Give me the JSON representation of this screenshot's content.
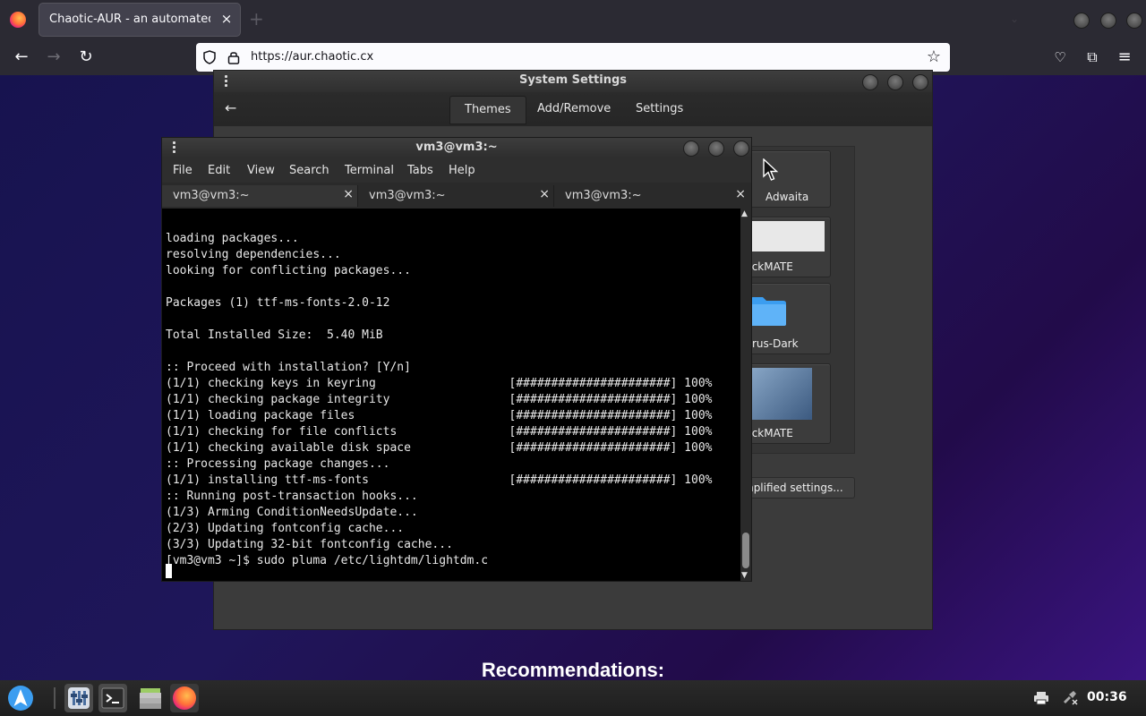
{
  "browser": {
    "tab_title": "Chaotic-AUR - an automated building repo for AUR packages",
    "tab_close": "×",
    "new_tab": "+",
    "url": "https://aur.chaotic.cx"
  },
  "page": {
    "heading": "Recommendations:"
  },
  "system_settings": {
    "title": "System Settings",
    "back": "←",
    "tabs": [
      "Themes",
      "Add/Remove",
      "Settings"
    ],
    "themes": [
      {
        "label": "Adwaita"
      },
      {
        "label": "lackMATE"
      },
      {
        "label": "pirus-Dark"
      },
      {
        "label": "lackMATE"
      }
    ],
    "simplified_button": "mplified settings..."
  },
  "terminal": {
    "title": "vm3@vm3:~",
    "menu": [
      "File",
      "Edit",
      "View",
      "Search",
      "Terminal",
      "Tabs",
      "Help"
    ],
    "tabs": [
      {
        "label": "vm3@vm3:~",
        "close": "×"
      },
      {
        "label": "vm3@vm3:~",
        "close": "×"
      },
      {
        "label": "vm3@vm3:~",
        "close": "×"
      }
    ],
    "lines": [
      "loading packages...",
      "resolving dependencies...",
      "looking for conflicting packages...",
      "",
      "Packages (1) ttf-ms-fonts-2.0-12",
      "",
      "Total Installed Size:  5.40 MiB",
      "",
      ":: Proceed with installation? [Y/n]",
      "(1/1) checking keys in keyring                   [######################] 100%",
      "(1/1) checking package integrity                 [######################] 100%",
      "(1/1) loading package files                      [######################] 100%",
      "(1/1) checking for file conflicts                [######################] 100%",
      "(1/1) checking available disk space              [######################] 100%",
      ":: Processing package changes...",
      "(1/1) installing ttf-ms-fonts                    [######################] 100%",
      ":: Running post-transaction hooks...",
      "(1/3) Arming ConditionNeedsUpdate...",
      "(2/3) Updating fontconfig cache...",
      "(3/3) Updating 32-bit fontconfig cache...",
      "[vm3@vm3 ~]$ sudo pluma /etc/lightdm/lightdm.c"
    ]
  },
  "taskbar": {
    "clock": "00:36"
  },
  "colors": {
    "page_bg": "#1f165a",
    "terminal_bg": "#000000",
    "accent_blue": "#3b9df0"
  }
}
